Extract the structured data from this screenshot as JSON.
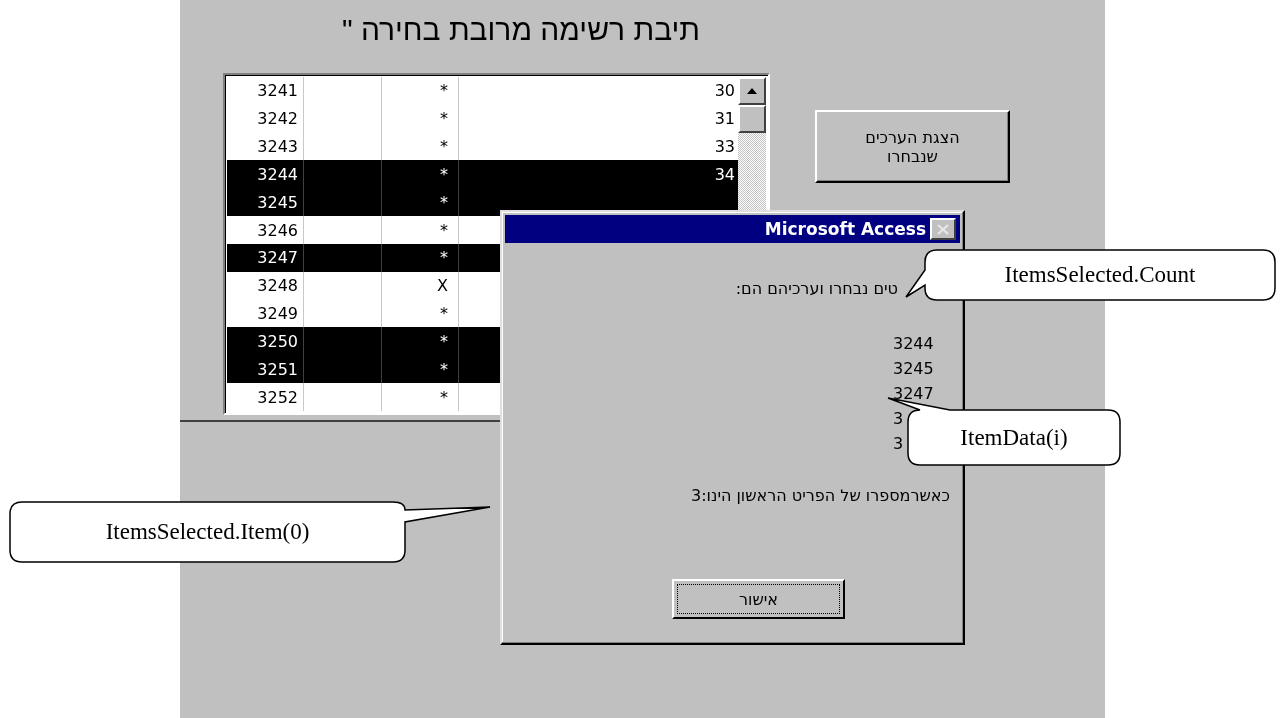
{
  "form": {
    "title": "תיבת רשימה מרובת בחירה \"",
    "list": {
      "rows": [
        {
          "column_1": "3241",
          "column_3": "*",
          "column_4": "30",
          "selected": false
        },
        {
          "column_1": "3242",
          "column_3": "*",
          "column_4": "31",
          "selected": false
        },
        {
          "column_1": "3243",
          "column_3": "*",
          "column_4": "33",
          "selected": false
        },
        {
          "column_1": "3244",
          "column_3": "*",
          "column_4": "34",
          "selected": true
        },
        {
          "column_1": "3245",
          "column_3": "*",
          "selected": true
        },
        {
          "column_1": "3246",
          "column_3": "*",
          "selected": false
        },
        {
          "column_1": "3247",
          "column_3": "*",
          "selected": true
        },
        {
          "column_1": "3248",
          "column_3": "X",
          "selected": false
        },
        {
          "column_1": "3249",
          "column_3": "*",
          "selected": false
        },
        {
          "column_1": "3250",
          "column_3": "*",
          "selected": true
        },
        {
          "column_1": "3251",
          "column_3": "*",
          "selected": true
        },
        {
          "column_1": "3252",
          "column_3": "*",
          "selected": false
        }
      ]
    },
    "show_button": "הצגת הערכים שנבחרו"
  },
  "dialog": {
    "title": "Microsoft Access",
    "message": "טים נבחרו וערכיהם הם:",
    "values": [
      "3244",
      "3245",
      "3247",
      "3",
      "3"
    ],
    "footer": "כאשרמספרו של הפריט הראשון הינו:3",
    "ok_button": "אישור"
  },
  "callouts": [
    {
      "text": "ItemsSelected.Count"
    },
    {
      "text": "ItemData(i)"
    },
    {
      "text": "ItemsSelected.Item(0)"
    }
  ]
}
